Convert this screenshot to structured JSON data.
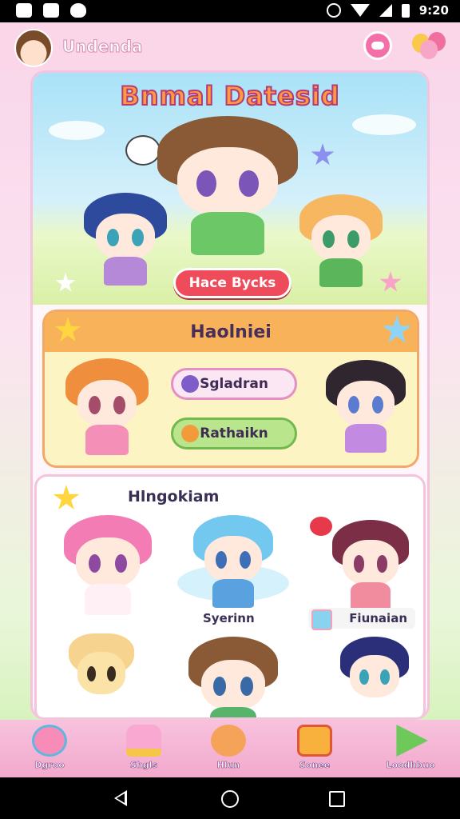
{
  "status_bar": {
    "time": "9:20"
  },
  "header": {
    "title": "Undenda"
  },
  "hero": {
    "title": "Bnmal Datesid",
    "button_label": "Hace Bycks"
  },
  "section_picks": {
    "title": "Haolniei",
    "options": [
      {
        "label": "Sgladran"
      },
      {
        "label": "Rathaikn"
      }
    ]
  },
  "section_characters": {
    "title": "Hlngokiam",
    "label_1": "Syerinn",
    "label_2": "Fiunaian"
  },
  "bottom_nav": {
    "items": [
      {
        "label": "Dgroo",
        "icon": "potion-icon"
      },
      {
        "label": "Shgls",
        "icon": "cake-icon"
      },
      {
        "label": "Hlun",
        "icon": "character-icon"
      },
      {
        "label": "Sonee",
        "icon": "box-icon"
      },
      {
        "label": "Loodhbuo",
        "icon": "play-icon"
      }
    ]
  },
  "colors": {
    "header_bg": "#fbd6e8",
    "accent_pink": "#f36fa8",
    "hero_button": "#ef4c5b",
    "section_orange": "#f8b35a",
    "option_green": "#b9e68c"
  }
}
